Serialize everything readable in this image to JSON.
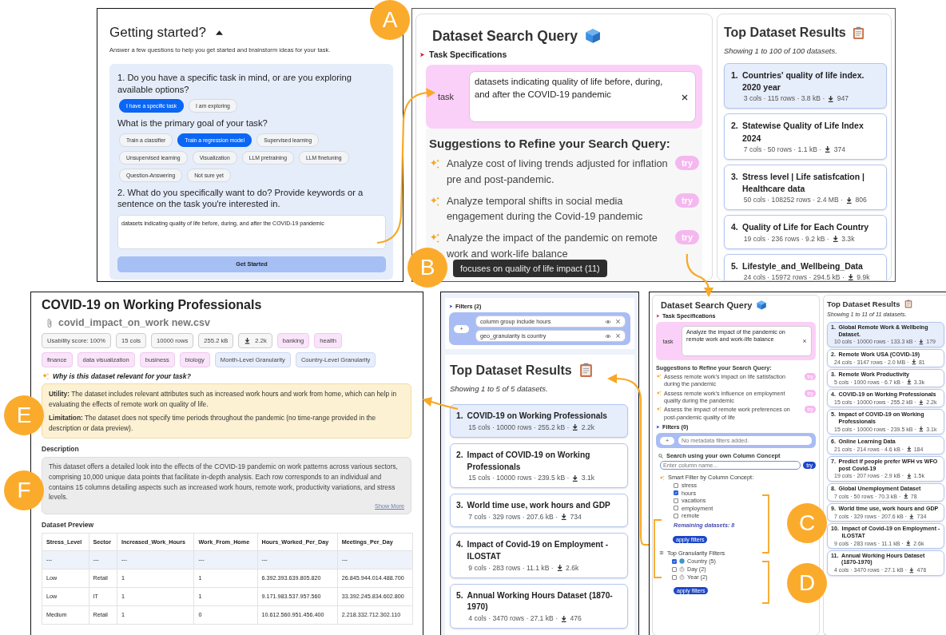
{
  "getting_started": {
    "title": "Getting started?",
    "subtitle": "Answer a few questions to help you get started and brainstorm ideas for your task.",
    "question_1": "1. Do you have a specific task in mind, or are you exploring available options?",
    "mode_options": [
      {
        "label": "I have a specific task",
        "selected": true
      },
      {
        "label": "I am exploring",
        "selected": false
      }
    ],
    "goal_question": "What is the primary goal of your task?",
    "goal_options": [
      {
        "label": "Train a classifier",
        "selected": false
      },
      {
        "label": "Train a regression model",
        "selected": true
      },
      {
        "label": "Supervised learning",
        "selected": false
      },
      {
        "label": "Unsupervised learning",
        "selected": false
      },
      {
        "label": "Visualization",
        "selected": false
      },
      {
        "label": "LLM pretraining",
        "selected": false
      },
      {
        "label": "LLM finetuning",
        "selected": false
      },
      {
        "label": "Question-Answering",
        "selected": false
      },
      {
        "label": "Not sure yet",
        "selected": false
      }
    ],
    "question_2": "2. What do you specifically want to do? Provide keywords or a sentence on the task you're interested in.",
    "task_text": "datasets indicating quality of life before, during, and after the COVID-19 pandemic",
    "button": "Get Started"
  },
  "search_query": {
    "title": "Dataset Search Query",
    "section": "Task Specifications",
    "task_label": "task",
    "task_value": "datasets indicating quality of life before, during, and after the COVID-19 pandemic",
    "suggestions_title": "Suggestions to Refine your Search Query:",
    "suggestions": [
      {
        "text": "Analyze cost of living trends adjusted for inflation pre and post-pandemic.",
        "button": "try"
      },
      {
        "text": "Analyze temporal shifts in social media engagement during the Covid-19 pandemic",
        "button": "try"
      },
      {
        "text": "Analyze the impact of the pandemic on remote work and work-life balance",
        "button": "try"
      }
    ],
    "tooltip": "focuses on quality of life impact (11)"
  },
  "top_results": {
    "title": "Top Dataset Results",
    "subtitle": "Showing 1 to 100 of 100 datasets.",
    "results": [
      {
        "rank": "1.",
        "title": "Countries' quality of life index. 2020 year",
        "meta": "3 cols · 115 rows · 3.8 kB ·",
        "downloads": "947",
        "selected": true
      },
      {
        "rank": "2.",
        "title": "Statewise Quality of Life Index 2024",
        "meta": "7 cols · 50 rows · 1.1 kB ·",
        "downloads": "374",
        "selected": false
      },
      {
        "rank": "3.",
        "title": "Stress level | Life satisfcation | Healthcare data",
        "meta": "50 cols · 108252 rows · 2.4 MB ·",
        "downloads": "806",
        "selected": false
      },
      {
        "rank": "4.",
        "title": "Quality of Life for Each Country",
        "meta": "19 cols · 236 rows · 9.2 kB ·",
        "downloads": "3.3k",
        "selected": false
      },
      {
        "rank": "5.",
        "title": "Lifestyle_and_Wellbeing_Data",
        "meta": "24 cols · 15972 rows · 294.5 kB ·",
        "downloads": "9.9k",
        "selected": false
      }
    ]
  },
  "dataset_detail": {
    "title": "COVID-19 on Working Professionals",
    "filename": "covid_impact_on_work new.csv",
    "tags": [
      {
        "label": "Usability score: 100%",
        "kind": "stat"
      },
      {
        "label": "15 cols",
        "kind": "stat"
      },
      {
        "label": "10000 rows",
        "kind": "stat"
      },
      {
        "label": "255.2 kB",
        "kind": "stat"
      },
      {
        "label": "2.2k",
        "kind": "download"
      },
      {
        "label": "banking",
        "kind": "topic"
      },
      {
        "label": "health",
        "kind": "topic"
      },
      {
        "label": "finance",
        "kind": "topic"
      },
      {
        "label": "data visualization",
        "kind": "topic"
      },
      {
        "label": "business",
        "kind": "topic"
      },
      {
        "label": "biology",
        "kind": "topic"
      },
      {
        "label": "Month-Level Granularity",
        "kind": "granularity"
      },
      {
        "label": "Country-Level Granularity",
        "kind": "granularity"
      }
    ],
    "relevance_title": "Why is this dataset relevant for your task?",
    "utility": "**Utility:** The dataset includes relevant attributes such as increased work hours and work from home, which can help in evaluating the effects of remote work on quality of life.",
    "limitation": "**Limitation:** The dataset does not specify time periods throughout the pandemic (no time-range provided in the description or data preview).",
    "description_title": "Description",
    "description": "This dataset offers a detailed look into the effects of the COVID-19 pandemic on work patterns across various sectors, comprising 10,000 unique data points that facilitate in-depth analysis. Each row corresponds to an individual and contains 15 columns detailing aspects such as increased work hours, remote work, productivity variations, and stress levels.",
    "show_more": "Show More",
    "preview_title": "Dataset Preview",
    "table": {
      "columns": [
        "Stress_Level",
        "Sector",
        "Increased_Work_Hours",
        "Work_From_Home",
        "Hours_Worked_Per_Day",
        "Meetings_Per_Day"
      ],
      "rows": [
        [
          "---",
          "---",
          "---",
          "---",
          "---",
          "---"
        ],
        [
          "Low",
          "Retail",
          "1",
          "1",
          "6.392.393.639.805.820",
          "26.845.944.014.488.700"
        ],
        [
          "Low",
          "IT",
          "1",
          "1",
          "9.171.983.537.957.560",
          "33.392.245.834.602.800"
        ],
        [
          "Medium",
          "Retail",
          "1",
          "0",
          "10.612.560.951.456.400",
          "2.218.332.712.302.110"
        ]
      ]
    }
  },
  "filtered_results": {
    "filters_title": "Filters (2)",
    "add_button": "+",
    "filters": [
      {
        "text": "column group include hours"
      },
      {
        "text": "geo_granularity is country"
      }
    ],
    "title": "Top Dataset Results",
    "subtitle": "Showing 1 to 5 of 5 datasets.",
    "results": [
      {
        "rank": "1.",
        "title": "COVID-19 on Working Professionals",
        "meta": "15 cols · 10000 rows · 255.2 kB ·",
        "downloads": "2.2k",
        "selected": true
      },
      {
        "rank": "2.",
        "title": "Impact of COVID-19 on Working Professionals",
        "meta": "15 cols · 10000 rows · 239.5 kB ·",
        "downloads": "3.1k",
        "selected": false
      },
      {
        "rank": "3.",
        "title": "World time use, work hours and GDP",
        "meta": "7 cols · 329 rows · 207.6 kB ·",
        "downloads": "734",
        "selected": false
      },
      {
        "rank": "4.",
        "title": "Impact of Covid-19 on Employment - ILOSTAT",
        "meta": "9 cols · 283 rows · 11.1 kB ·",
        "downloads": "2.6k",
        "selected": false
      },
      {
        "rank": "5.",
        "title": "Annual Working Hours Dataset (1870-1970)",
        "meta": "4 cols · 3470 rows · 27.1 kB ·",
        "downloads": "476",
        "selected": false
      }
    ]
  },
  "refined_query": {
    "title": "Dataset Search Query",
    "section": "Task Specifications",
    "task_label": "task",
    "task_value": "Analyze the impact of the pandemic on remote work and work-life balance",
    "suggestions_title": "Suggestions to Refine your Search Query:",
    "suggestions": [
      {
        "text": "Assess remote work's impact on life satisfaction during the pandemic",
        "button": "try"
      },
      {
        "text": "Assess remote work's influence on employment quality during the pandemic",
        "button": "try"
      },
      {
        "text": "Assess the impact of remote work preferences on post-pandemic quality of life",
        "button": "try"
      }
    ],
    "filters_title": "Filters (0)",
    "add_button": "+",
    "filters_placeholder": "No metadata filters added.",
    "column_search_title": "Search using your own Column Concept",
    "column_placeholder": "Enter column name...",
    "column_button": "try",
    "smart_filter_title": "Smart Filter by Column Concept:",
    "concepts": [
      {
        "label": "stress",
        "checked": false
      },
      {
        "label": "hours",
        "checked": true
      },
      {
        "label": "vacations",
        "checked": false
      },
      {
        "label": "employment",
        "checked": false
      },
      {
        "label": "remote",
        "checked": false
      }
    ],
    "remaining": "Remaining datasets: 8",
    "apply_button": "apply filters",
    "granularity_title": "Top Granularity Filters",
    "granularities": [
      {
        "label": "Country (5)",
        "kind": "geo",
        "checked": true
      },
      {
        "label": "Day (2)",
        "kind": "time",
        "checked": false
      },
      {
        "label": "Year (2)",
        "kind": "time",
        "checked": false
      }
    ],
    "granularity_apply_button": "apply filters"
  },
  "refined_results": {
    "title": "Top Dataset Results",
    "subtitle": "Showing 1 to 11 of 11 datasets.",
    "results": [
      {
        "rank": "1.",
        "title": "Global Remote Work & Wellbeing Dataset.",
        "meta": "10 cols · 10000 rows · 133.3 kB ·",
        "downloads": "179",
        "selected": true
      },
      {
        "rank": "2.",
        "title": "Remote Work USA (COVID-19)",
        "meta": "24 cols · 3147 rows · 2.0 MB ·",
        "downloads": "81",
        "selected": false
      },
      {
        "rank": "3.",
        "title": "Remote Work Productivity",
        "meta": "5 cols · 1000 rows · 6.7 kB ·",
        "downloads": "3.3k",
        "selected": false
      },
      {
        "rank": "4.",
        "title": "COVID-19 on Working Professionals",
        "meta": "15 cols · 10000 rows · 255.2 kB ·",
        "downloads": "2.2k",
        "selected": false
      },
      {
        "rank": "5.",
        "title": "Impact of COVID-19 on Working Professionals",
        "meta": "15 cols · 10000 rows · 239.5 kB ·",
        "downloads": "3.1k",
        "selected": false
      },
      {
        "rank": "6.",
        "title": "Online Learning Data",
        "meta": "21 cols · 214 rows · 4.6 kB ·",
        "downloads": "184",
        "selected": false
      },
      {
        "rank": "7.",
        "title": "Predict if people prefer WFH vs WFO post Covid-19",
        "meta": "19 cols · 207 rows · 2.9 kB ·",
        "downloads": "1.5k",
        "selected": false
      },
      {
        "rank": "8.",
        "title": "Global Unemployment Dataset",
        "meta": "7 cols · 50 rows · 70.3 kB ·",
        "downloads": "78",
        "selected": false
      },
      {
        "rank": "9.",
        "title": "World time use, work hours and GDP",
        "meta": "7 cols · 329 rows · 207.6 kB ·",
        "downloads": "734",
        "selected": false
      },
      {
        "rank": "10.",
        "title": "Impact of Covid-19 on Employment - ILOSTAT",
        "meta": "9 cols · 283 rows · 11.1 kB ·",
        "downloads": "2.6k",
        "selected": false
      },
      {
        "rank": "11.",
        "title": "Annual Working Hours Dataset (1870-1970)",
        "meta": "4 cols · 3470 rows · 27.1 kB ·",
        "downloads": "476",
        "selected": false
      }
    ]
  },
  "callouts": [
    {
      "label": "A"
    },
    {
      "label": "B"
    },
    {
      "label": "C"
    },
    {
      "label": "D"
    },
    {
      "label": "E"
    },
    {
      "label": "F"
    }
  ]
}
